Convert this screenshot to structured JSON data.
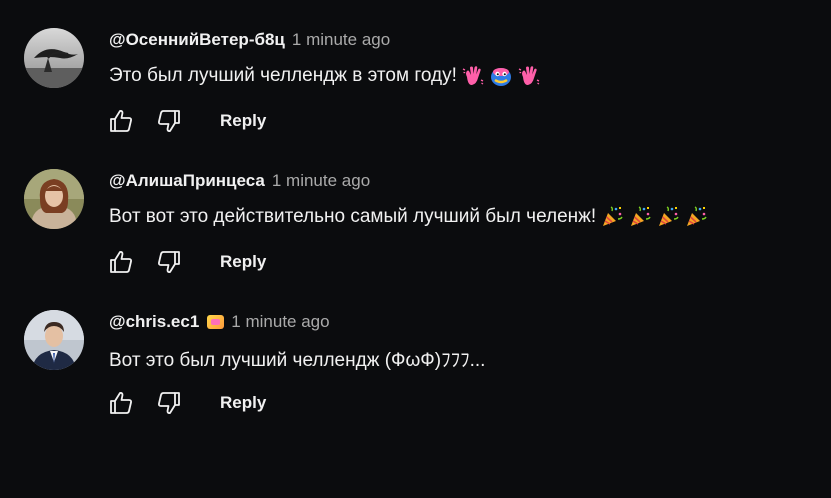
{
  "comments": [
    {
      "author": "@ОсеннийВетер-б8ц",
      "time": "1 minute ago",
      "text": "Это был лучший челлендж в этом году!",
      "emojis": [
        "waving-hand-icon",
        "blue-face-icon",
        "waving-hand-icon"
      ],
      "avatar": "tree-avatar",
      "reply_label": "Reply"
    },
    {
      "author": "@АлишаПринцеса",
      "time": "1 minute ago",
      "text": "Вот вот это действительно самый лучший был челенж!",
      "emojis": [
        "party-popper-icon",
        "party-popper-icon",
        "party-popper-icon",
        "party-popper-icon"
      ],
      "avatar": "girl-avatar",
      "reply_label": "Reply"
    },
    {
      "author": "@chris.ec1",
      "time": "1 minute ago",
      "text": "Вот это был лучший челлендж (ФωФ)ﾌﾌﾌ...",
      "emojis": [],
      "avatar": "man-suit-avatar",
      "has_member_badge": true,
      "reply_label": "Reply"
    }
  ],
  "colors": {
    "background": "#0b0c0e",
    "text": "#f1f1f1",
    "muted": "#aaaaaa"
  }
}
